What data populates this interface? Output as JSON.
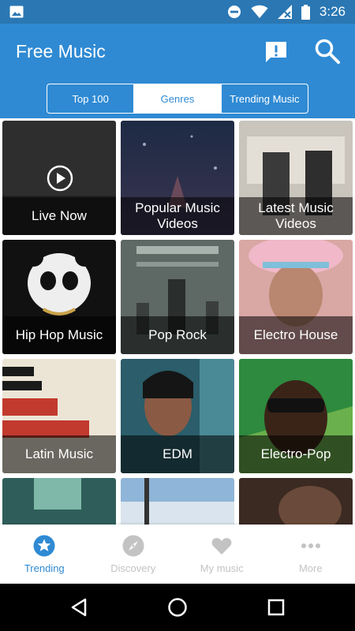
{
  "status_bar": {
    "time": "3:26",
    "icons": [
      "image-icon",
      "do-not-disturb-icon",
      "wifi-icon",
      "signal-off-icon",
      "battery-icon"
    ]
  },
  "app_bar": {
    "title": "Free Music",
    "actions": [
      "feedback-icon",
      "search-icon"
    ],
    "color": "#2f8ad3"
  },
  "tabs": [
    {
      "label": "Top 100",
      "active": false
    },
    {
      "label": "Genres",
      "active": true
    },
    {
      "label": "Trending Music",
      "active": false
    }
  ],
  "genres": [
    {
      "label": "Live Now",
      "icon": "play-icon"
    },
    {
      "label": "Popular Music Videos"
    },
    {
      "label": "Latest Music Videos"
    },
    {
      "label": "Hip Hop Music"
    },
    {
      "label": "Pop Rock"
    },
    {
      "label": "Electro House"
    },
    {
      "label": "Latin Music"
    },
    {
      "label": "EDM"
    },
    {
      "label": "Electro-Pop"
    }
  ],
  "bottom_nav": [
    {
      "label": "Trending",
      "icon": "star-icon",
      "active": true
    },
    {
      "label": "Discovery",
      "icon": "compass-icon",
      "active": false
    },
    {
      "label": "My music",
      "icon": "heart-icon",
      "active": false
    },
    {
      "label": "More",
      "icon": "more-dots-icon",
      "active": false
    }
  ],
  "system_nav": [
    "back-icon",
    "home-icon",
    "recents-icon"
  ],
  "colors": {
    "accent": "#2f8ad3",
    "status_bar": "#2a77b3",
    "inactive": "#c3c3c3"
  }
}
